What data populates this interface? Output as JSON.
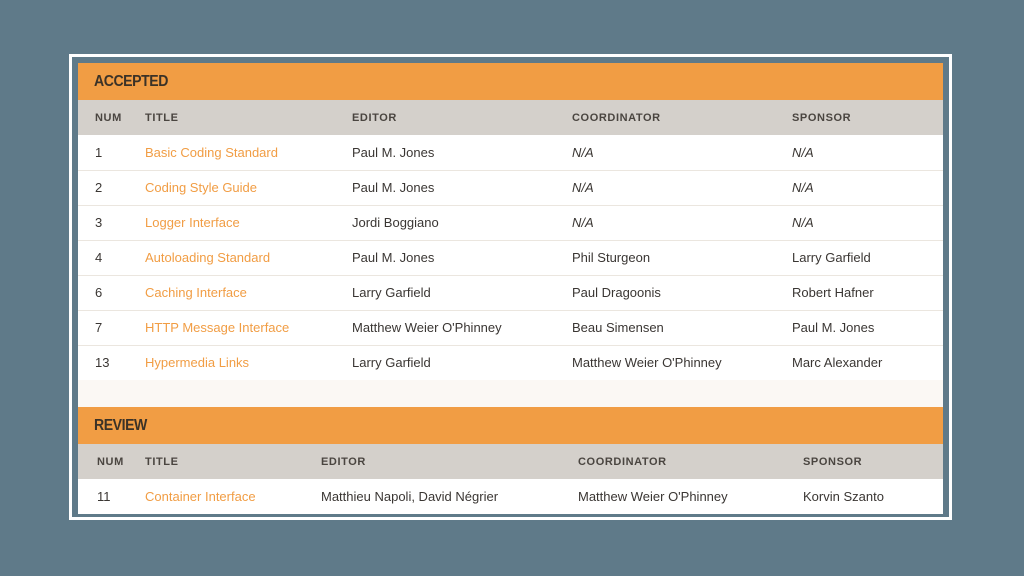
{
  "accepted": {
    "heading": "ACCEPTED",
    "columns": [
      "NUM",
      "TITLE",
      "EDITOR",
      "COORDINATOR",
      "SPONSOR"
    ],
    "rows": [
      {
        "num": "1",
        "title": "Basic Coding Standard",
        "editor": "Paul M. Jones",
        "coordinator": "N/A",
        "sponsor": "N/A"
      },
      {
        "num": "2",
        "title": "Coding Style Guide",
        "editor": "Paul M. Jones",
        "coordinator": "N/A",
        "sponsor": "N/A"
      },
      {
        "num": "3",
        "title": "Logger Interface",
        "editor": "Jordi Boggiano",
        "coordinator": "N/A",
        "sponsor": "N/A"
      },
      {
        "num": "4",
        "title": "Autoloading Standard",
        "editor": "Paul M. Jones",
        "coordinator": "Phil Sturgeon",
        "sponsor": "Larry Garfield"
      },
      {
        "num": "6",
        "title": "Caching Interface",
        "editor": "Larry Garfield",
        "coordinator": "Paul Dragoonis",
        "sponsor": "Robert Hafner"
      },
      {
        "num": "7",
        "title": "HTTP Message Interface",
        "editor": "Matthew Weier O'Phinney",
        "coordinator": "Beau Simensen",
        "sponsor": "Paul M. Jones"
      },
      {
        "num": "13",
        "title": "Hypermedia Links",
        "editor": "Larry Garfield",
        "coordinator": "Matthew Weier O'Phinney",
        "sponsor": "Marc Alexander"
      }
    ]
  },
  "review": {
    "heading": "REVIEW",
    "columns": [
      "NUM",
      "TITLE",
      "EDITOR",
      "COORDINATOR",
      "SPONSOR"
    ],
    "rows": [
      {
        "num": "11",
        "title": "Container Interface",
        "editor": "Matthieu Napoli, David Négrier",
        "coordinator": "Matthew Weier O'Phinney",
        "sponsor": "Korvin Szanto"
      }
    ]
  },
  "colors": {
    "background": "#5f7a89",
    "accent": "#f19d44",
    "header_row": "#d4d0cb",
    "panel": "#fbf8f4"
  }
}
